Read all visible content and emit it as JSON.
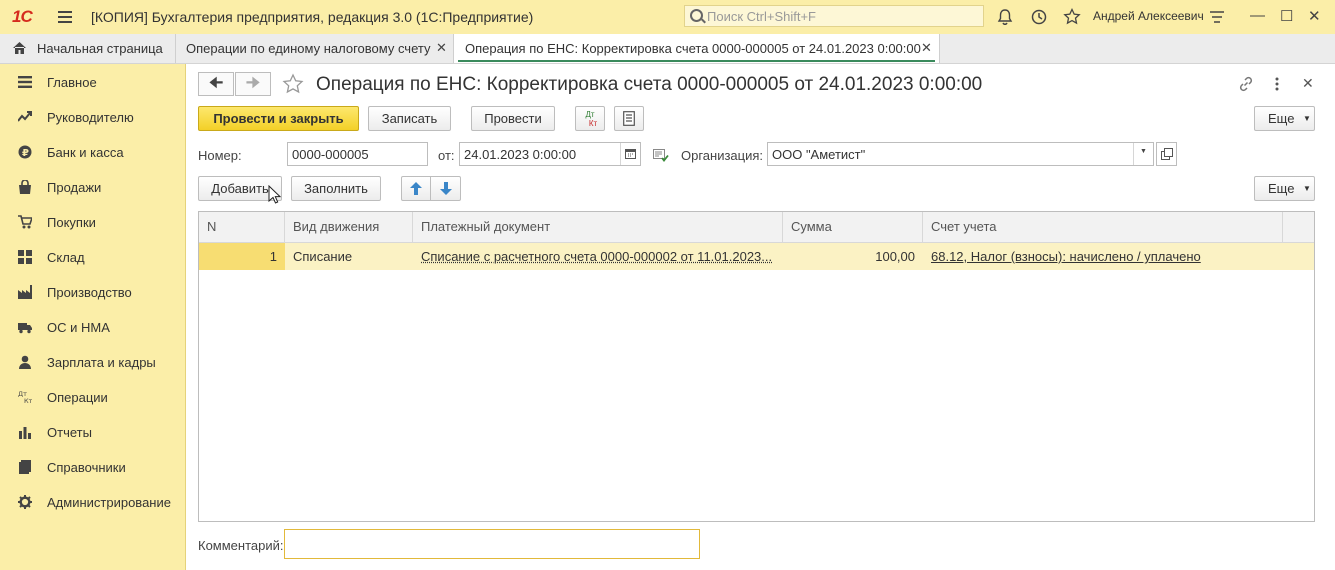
{
  "window": {
    "logo": "1С",
    "title": "[КОПИЯ] Бухгалтерия предприятия, редакция 3.0  (1С:Предприятие)",
    "search_placeholder": "Поиск Ctrl+Shift+F",
    "user": "Андрей Алексеевич"
  },
  "tabs": [
    {
      "label": "Начальная страница"
    },
    {
      "label": "Операции по единому налоговому счету",
      "close": "✕"
    },
    {
      "label": "Операция по ЕНС: Корректировка счета 0000-000005 от 24.01.2023 0:00:00",
      "close": "✕"
    }
  ],
  "sidebar": {
    "items": [
      {
        "label": "Главное",
        "icon": "list-icon"
      },
      {
        "label": "Руководителю",
        "icon": "trend-icon"
      },
      {
        "label": "Банк и касса",
        "icon": "coin-icon"
      },
      {
        "label": "Продажи",
        "icon": "bag-icon"
      },
      {
        "label": "Покупки",
        "icon": "cart-icon"
      },
      {
        "label": "Склад",
        "icon": "warehouse-icon"
      },
      {
        "label": "Производство",
        "icon": "factory-icon"
      },
      {
        "label": "ОС и НМА",
        "icon": "truck-icon"
      },
      {
        "label": "Зарплата и кадры",
        "icon": "person-icon"
      },
      {
        "label": "Операции",
        "icon": "dt-kt-icon"
      },
      {
        "label": "Отчеты",
        "icon": "bar-chart-icon"
      },
      {
        "label": "Справочники",
        "icon": "book-icon"
      },
      {
        "label": "Администрирование",
        "icon": "gear-icon"
      }
    ]
  },
  "form": {
    "title": "Операция по ЕНС: Корректировка счета 0000-000005 от 24.01.2023 0:00:00",
    "post_close_label": "Провести и закрыть",
    "save_label": "Записать",
    "post_label": "Провести",
    "dtkt_label_top": "Дт",
    "dtkt_label_bottom": "Кт",
    "more_label": "Еще",
    "number_label": "Номер:",
    "number_value": "0000-000005",
    "date_label": "от:",
    "date_value": "24.01.2023  0:00:00",
    "org_label": "Организация:",
    "org_value": "ООО \"Аметист\"",
    "add_label": "Добавить",
    "fill_label": "Заполнить",
    "more2_label": "Еще",
    "comment_label": "Комментарий:",
    "comment_value": ""
  },
  "table": {
    "columns": [
      "N",
      "Вид движения",
      "Платежный документ",
      "Сумма",
      "Счет учета"
    ],
    "rows": [
      {
        "n": "1",
        "movement": "Списание",
        "document": "Списание с расчетного счета 0000-000002 от 11.01.2023...",
        "amount": "100,00",
        "account": "68.12, Налог (взносы): начислено / уплачено"
      }
    ]
  },
  "colors": {
    "accent_yellow": "#fbeea8",
    "primary_button": "#f3d027",
    "active_tab_underline": "#3a8a5c",
    "row_highlight": "#fbf2c4"
  }
}
